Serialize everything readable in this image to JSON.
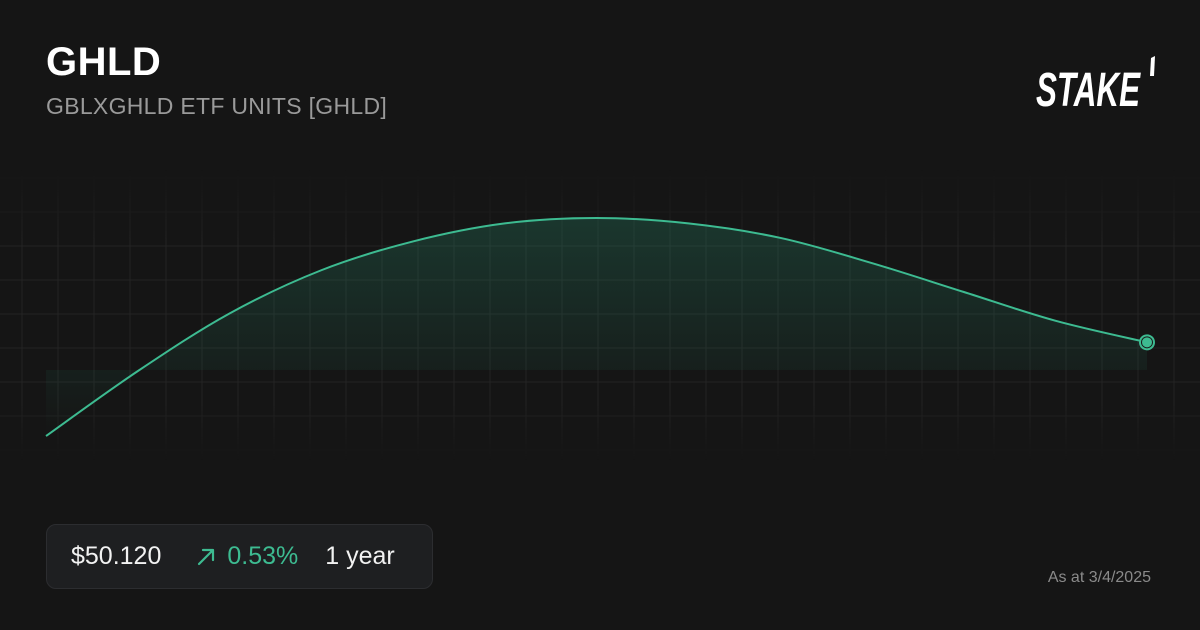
{
  "header": {
    "ticker": "GHLD",
    "fullname": "GBLXGHLD ETF UNITS [GHLD]"
  },
  "brand": {
    "logo_text": "STAKE",
    "logo_color": "#ffffff"
  },
  "summary": {
    "price": "$50.120",
    "change_icon": "arrow-up-right-icon",
    "change": "0.53%",
    "period": "1 year",
    "as_at": "As at 3/4/2025"
  },
  "colors": {
    "background": "#151515",
    "accent": "#3dbb91",
    "grid": "#232323"
  },
  "chart_data": {
    "type": "line",
    "title": "",
    "xlabel": "",
    "ylabel": "",
    "grid": true,
    "x": [
      0,
      1,
      2,
      3,
      4,
      5,
      6,
      7,
      8,
      9,
      10,
      11,
      12
    ],
    "values": [
      49.86,
      50.04,
      50.2,
      50.32,
      50.4,
      50.45,
      50.465,
      50.45,
      50.41,
      50.34,
      50.26,
      50.18,
      50.12
    ],
    "ylim": [
      49.86,
      50.465
    ]
  }
}
